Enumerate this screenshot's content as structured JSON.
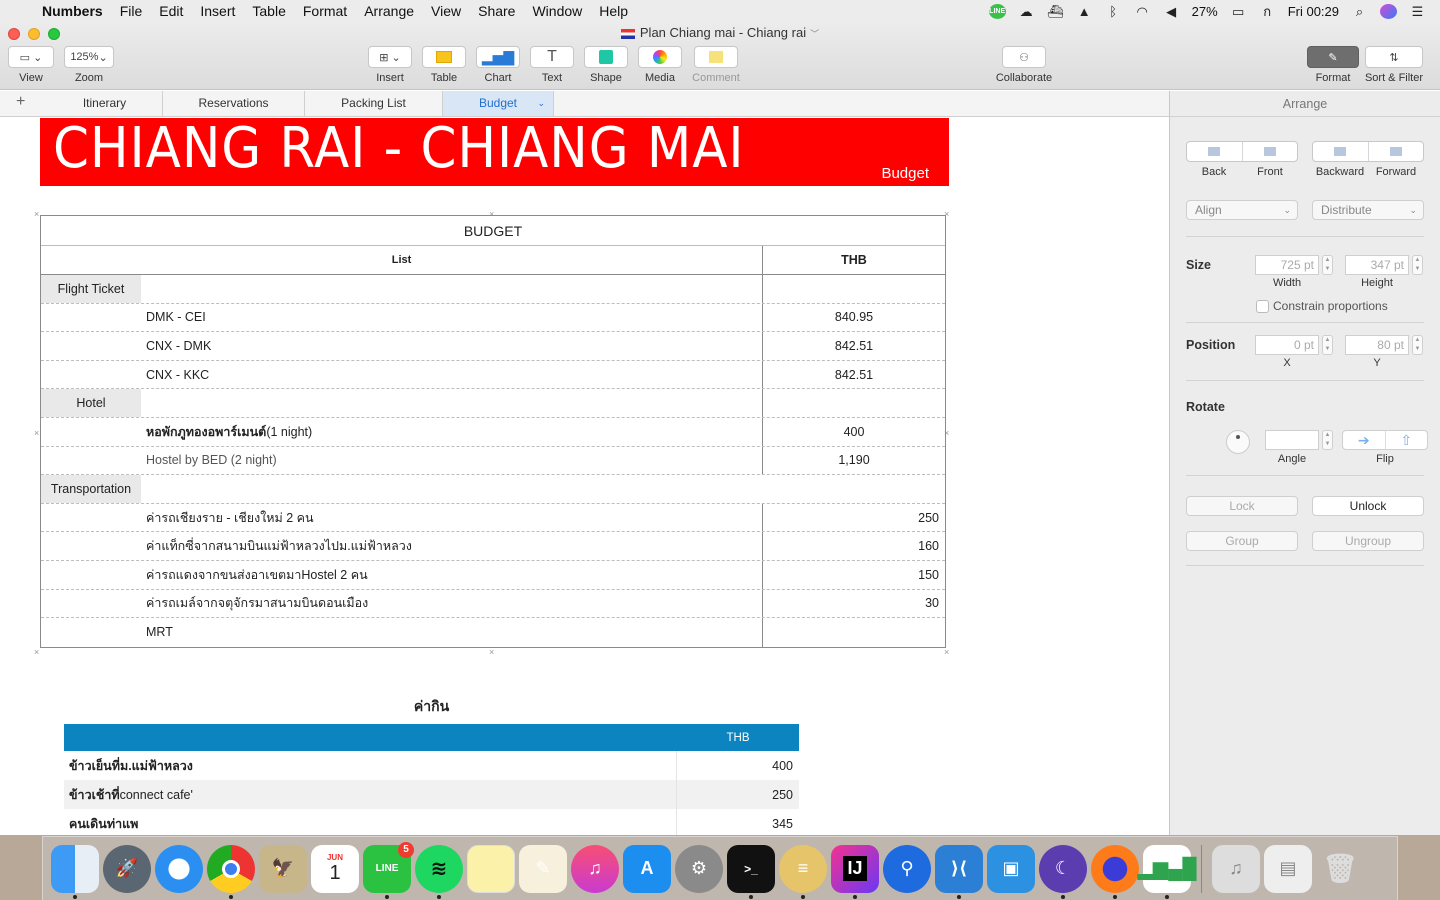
{
  "menubar": {
    "app_name": "Numbers",
    "items": [
      "File",
      "Edit",
      "Insert",
      "Table",
      "Format",
      "Arrange",
      "View",
      "Share",
      "Window",
      "Help"
    ],
    "battery": "27%",
    "clock": "Fri 00:29"
  },
  "window": {
    "title": "Plan Chiang mai - Chiang rai"
  },
  "toolbar": {
    "view": "View",
    "zoom_value": "125%",
    "zoom": "Zoom",
    "insert": "Insert",
    "table": "Table",
    "chart": "Chart",
    "text": "Text",
    "shape": "Shape",
    "media": "Media",
    "comment": "Comment",
    "collaborate": "Collaborate",
    "format": "Format",
    "sort_filter": "Sort & Filter"
  },
  "tabs": [
    "Itinerary",
    "Reservations",
    "Packing List",
    "Budget"
  ],
  "active_tab": "Budget",
  "banner": {
    "title": "CHIANG RAI - CHIANG MAI",
    "subtitle": "Budget",
    "color": "#ff0000"
  },
  "budget": {
    "title": "BUDGET",
    "col_list": "List",
    "col_thb": "THB",
    "rows": [
      {
        "cat": "Flight Ticket",
        "item": "",
        "val": ""
      },
      {
        "cat": "",
        "item": "DMK -  CEI",
        "val": "840.95"
      },
      {
        "cat": "",
        "item": "CNX - DMK",
        "val": "842.51"
      },
      {
        "cat": "",
        "item": "CNX - KKC",
        "val": "842.51"
      },
      {
        "cat": "Hotel",
        "item": "",
        "val": ""
      },
      {
        "cat": "",
        "item_bold": "หอพักภูทองอพาร์เมนต์",
        "item": " (1 night)",
        "val": "400"
      },
      {
        "cat": "",
        "item": "Hostel by BED (2 night)",
        "val": "1,190"
      },
      {
        "cat": "Transportation",
        "item": "",
        "val": ""
      },
      {
        "cat": "",
        "item": "ค่ารถเชียงราย -  เชียงใหม่ 2 คน",
        "val": "250"
      },
      {
        "cat": "",
        "item": "ค่าแท็กซี่จากสนามบินแม่ฟ้าหลวงไปม.แม่ฟ้าหลวง",
        "val": "160"
      },
      {
        "cat": "",
        "item": "ค่ารถแดงจากขนส่งอาเขตมาHostel 2 คน",
        "val": "150"
      },
      {
        "cat": "",
        "item": "ค่ารถเมล์จากจตุจักรมาสนามบินดอนเมือง",
        "val": "30"
      },
      {
        "cat": "",
        "item": "MRT",
        "val": ""
      }
    ]
  },
  "food": {
    "title": "ค่ากิน",
    "col_thb": "THB",
    "header_color": "#0b84c0",
    "rows": [
      {
        "bold": "ข้าวเย็นที่ม.แม่ฟ้าหลวง",
        "normal": "",
        "val": "400"
      },
      {
        "bold": "ข้าวเช้าที่",
        "normal": " connect cafe'",
        "val": "250"
      },
      {
        "bold": "คนเดินท่าแพ",
        "normal": "",
        "val": "345"
      }
    ]
  },
  "inspector": {
    "title": "Arrange",
    "back": "Back",
    "front": "Front",
    "backward": "Backward",
    "forward": "Forward",
    "align": "Align",
    "distribute": "Distribute",
    "size_label": "Size",
    "width_value": "725 pt",
    "height_value": "347 pt",
    "width_label": "Width",
    "height_label": "Height",
    "constrain": "Constrain proportions",
    "position_label": "Position",
    "x_value": "0 pt",
    "y_value": "80 pt",
    "x_label": "X",
    "y_label": "Y",
    "rotate_label": "Rotate",
    "angle_label": "Angle",
    "flip_label": "Flip",
    "lock": "Lock",
    "unlock": "Unlock",
    "group": "Group",
    "ungroup": "Ungroup"
  },
  "dock": {
    "line_badge": "5",
    "calendar_month": "JUN",
    "calendar_day": "1"
  }
}
